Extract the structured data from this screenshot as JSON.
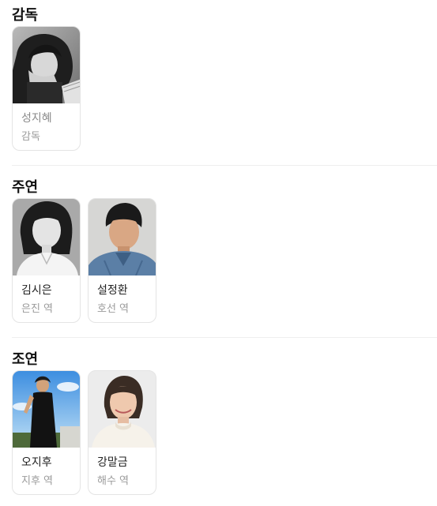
{
  "sections": [
    {
      "title": "감독",
      "people": [
        {
          "name": "성지혜",
          "role": "감독",
          "photo_icon": "director-photo-bw"
        }
      ]
    },
    {
      "title": "주연",
      "people": [
        {
          "name": "김시은",
          "role": "은진 역",
          "photo_icon": "actress-photo-bw"
        },
        {
          "name": "설정환",
          "role": "호선 역",
          "photo_icon": "actor-photo-denim"
        }
      ]
    },
    {
      "title": "조연",
      "people": [
        {
          "name": "오지후",
          "role": "지후 역",
          "photo_icon": "actress-photo-sky"
        },
        {
          "name": "강말금",
          "role": "해수 역",
          "photo_icon": "actress-photo-white"
        }
      ]
    }
  ],
  "colors": {
    "title": "#111111",
    "name": "#222222",
    "name_dim": "#8a8a8a",
    "role": "#9a9a9a",
    "card_border": "#e4e4e4",
    "divider": "#eeeeee"
  }
}
